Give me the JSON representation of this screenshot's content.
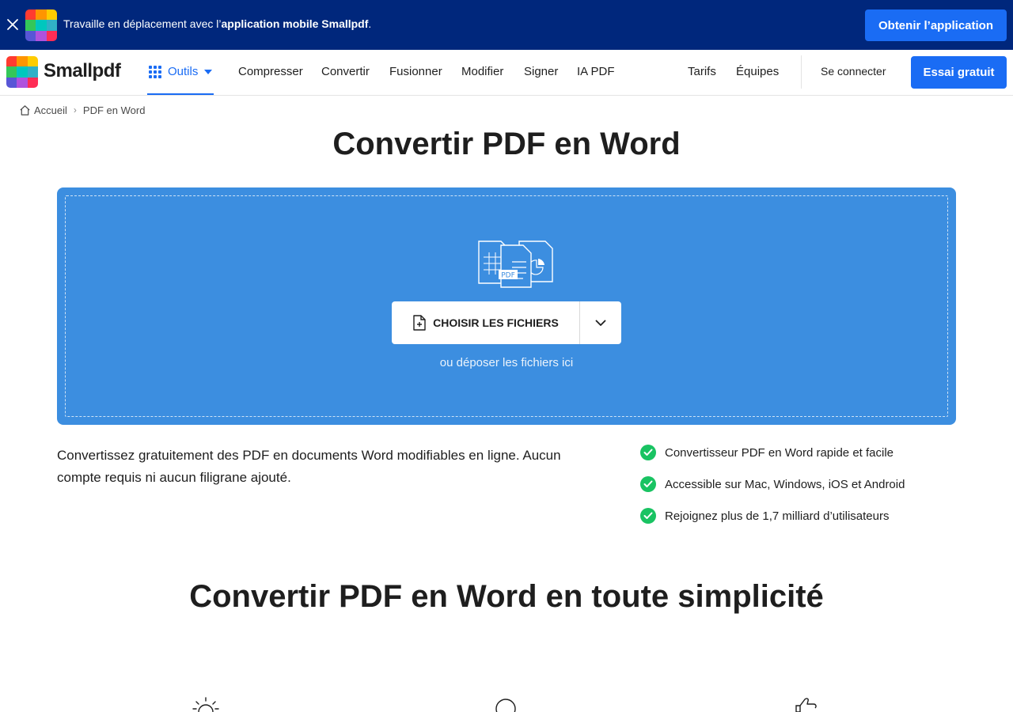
{
  "banner": {
    "text_prefix": "Travaille en déplacement avec l’",
    "text_bold": "application mobile Smallpdf",
    "text_suffix": ".",
    "button": "Obtenir l’application"
  },
  "logo_colors": [
    "#ff3b30",
    "#ff9500",
    "#ffcc00",
    "#34c759",
    "#00c7be",
    "#30b0c7",
    "#5856d6",
    "#af52de",
    "#ff2d55"
  ],
  "nav": {
    "brand": "Smallpdf",
    "tools": "Outils",
    "links": [
      "Compresser",
      "Convertir",
      "Fusionner",
      "Modifier",
      "Signer",
      "IA PDF"
    ],
    "right_links": [
      "Tarifs",
      "Équipes"
    ],
    "login": "Se connecter",
    "cta": "Essai gratuit"
  },
  "breadcrumb": {
    "home": "Accueil",
    "current": "PDF en Word"
  },
  "page": {
    "title": "Convertir PDF en Word"
  },
  "dropzone": {
    "pdf_tag": "PDF",
    "choose_button": "CHOISIR LES FICHIERS",
    "hint": "ou déposer les fichiers ici"
  },
  "description": "Convertissez gratuitement des PDF en documents Word modifiables en ligne. Aucun compte requis ni aucun filigrane ajouté.",
  "features": [
    "Convertisseur PDF en Word rapide et facile",
    "Accessible sur Mac, Windows, iOS et Android",
    "Rejoignez plus de 1,7 milliard d’utilisateurs"
  ],
  "section": {
    "title": "Convertir PDF en Word en toute simplicité"
  },
  "colors": {
    "banner_bg": "#00277c",
    "accent": "#1a6cf4",
    "dropzone": "#3c8ee0",
    "check": "#19c362"
  },
  "icons": {
    "bottom": [
      "lightbulb-icon",
      "circle-icon",
      "thumbs-up-icon"
    ]
  }
}
